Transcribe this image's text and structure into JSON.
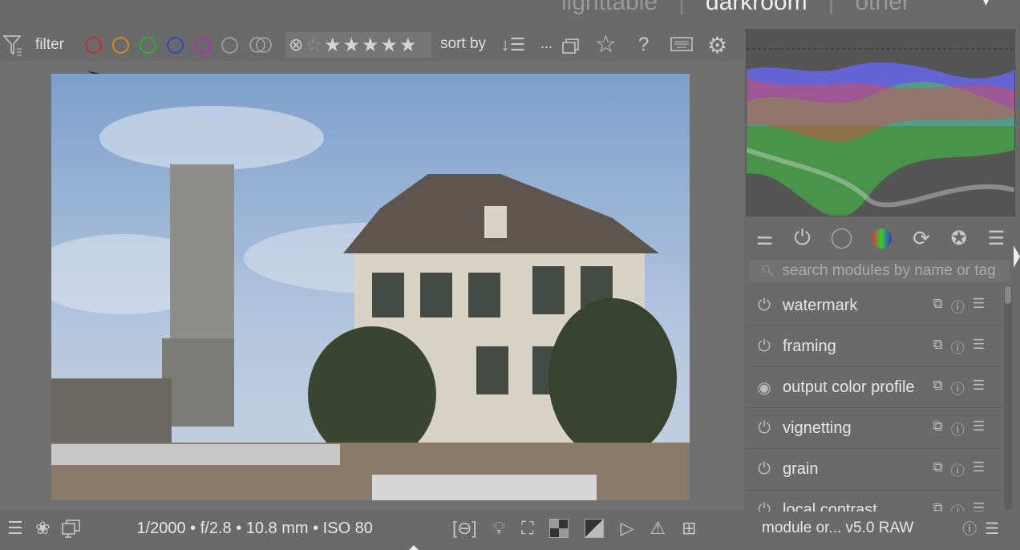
{
  "views": {
    "lighttable": "lighttable",
    "darkroom": "darkroom",
    "other": "other",
    "dropdown": "▾"
  },
  "filterbar": {
    "filter_label": "filter",
    "sort_label": "sort by",
    "ellipsis": "...",
    "color_labels": [
      "#c03030",
      "#c8901e",
      "#2fb02f",
      "#3048c8",
      "#b030b0",
      "#9a9a9a"
    ]
  },
  "histogram": {
    "colors": [
      "#6a6aff",
      "#3fd43f",
      "#e04848"
    ]
  },
  "module_tools": {
    "search_placeholder": "search modules by name or tag"
  },
  "modules": [
    {
      "name": "watermark",
      "state": "off"
    },
    {
      "name": "framing",
      "state": "off"
    },
    {
      "name": "output color profile",
      "state": "always-on"
    },
    {
      "name": "vignetting",
      "state": "off"
    },
    {
      "name": "grain",
      "state": "off"
    },
    {
      "name": "local contrast",
      "state": "off"
    }
  ],
  "bottom": {
    "exif": "1/2000 • f/2.8 • 10.8 mm • ISO 80"
  },
  "right_bottom": {
    "module_order": "module or... v5.0 RAW"
  }
}
